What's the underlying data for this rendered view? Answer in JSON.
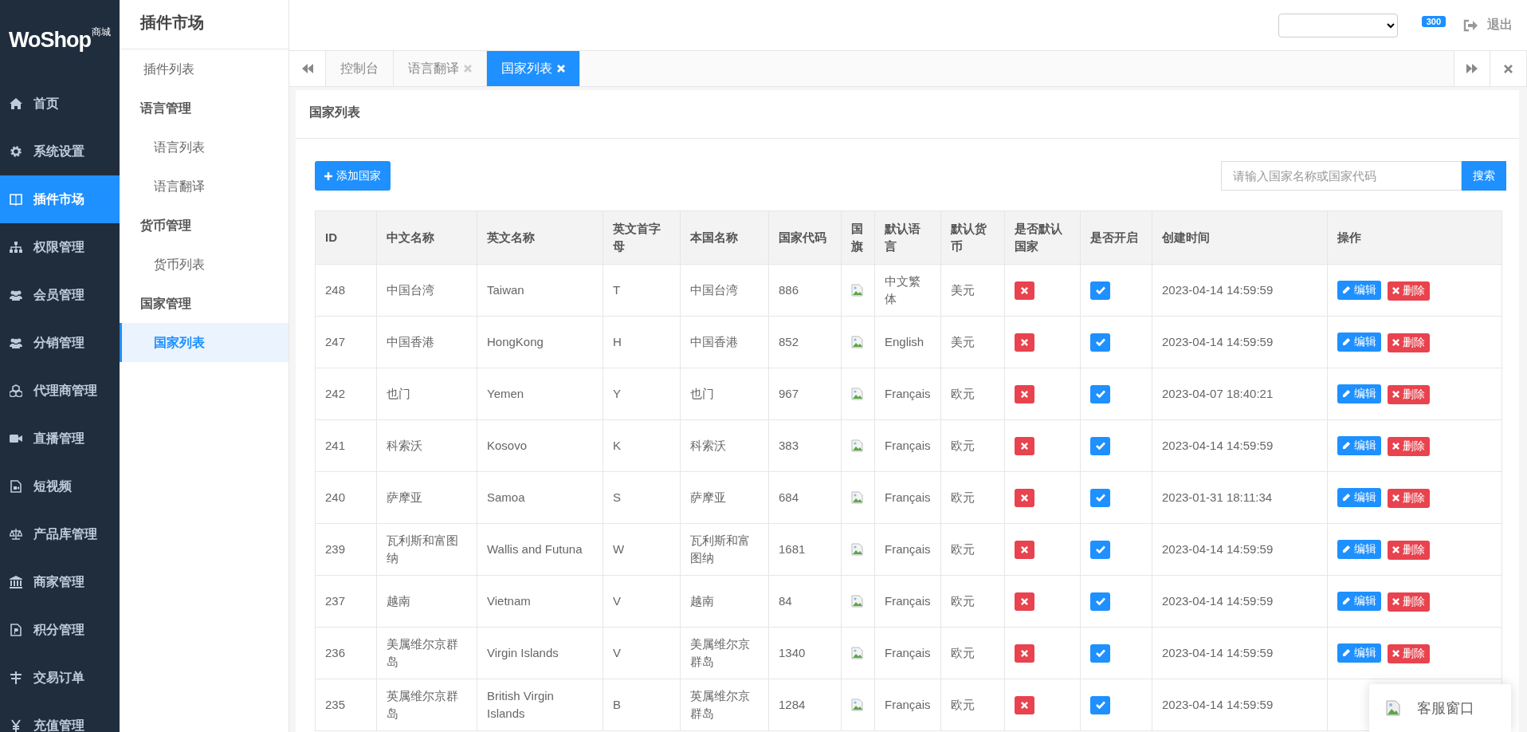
{
  "logo": {
    "text": "WoShop",
    "tag": "商城"
  },
  "nav": [
    {
      "label": "首页",
      "selected": false
    },
    {
      "label": "系统设置",
      "selected": false
    },
    {
      "label": "插件市场",
      "selected": true
    },
    {
      "label": "权限管理",
      "selected": false
    },
    {
      "label": "会员管理",
      "selected": false
    },
    {
      "label": "分销管理",
      "selected": false
    },
    {
      "label": "代理商管理",
      "selected": false
    },
    {
      "label": "直播管理",
      "selected": false
    },
    {
      "label": "短视频",
      "selected": false
    },
    {
      "label": "产品库管理",
      "selected": false
    },
    {
      "label": "商家管理",
      "selected": false
    },
    {
      "label": "积分管理",
      "selected": false
    },
    {
      "label": "交易订单",
      "selected": false
    },
    {
      "label": "充值管理",
      "selected": false
    }
  ],
  "subnav": {
    "title": "插件市场",
    "items": [
      {
        "label": "插件列表",
        "selected": false
      },
      {
        "label": "语言管理",
        "children": [
          {
            "label": "语言列表",
            "selected": false
          },
          {
            "label": "语言翻译",
            "selected": false
          }
        ]
      },
      {
        "label": "货币管理",
        "children": [
          {
            "label": "货币列表",
            "selected": false
          }
        ]
      },
      {
        "label": "国家管理",
        "children": [
          {
            "label": "国家列表",
            "selected": true
          }
        ]
      }
    ]
  },
  "topbar": {
    "badge": "300",
    "logout": "退出"
  },
  "tabs": [
    {
      "label": "控制台",
      "closable": false,
      "selected": false
    },
    {
      "label": "语言翻译",
      "closable": true,
      "selected": false
    },
    {
      "label": "国家列表",
      "closable": true,
      "selected": true
    }
  ],
  "panel": {
    "title": "国家列表",
    "add_button": "添加国家",
    "search": {
      "placeholder": "请输入国家名称或国家代码",
      "button": "搜索"
    }
  },
  "table": {
    "columns": [
      "ID",
      "中文名称",
      "英文名称",
      "英文首字母",
      "本国名称",
      "国家代码",
      "国旗",
      "默认语言",
      "默认货币",
      "是否默认国家",
      "是否开启",
      "创建时间",
      "操作"
    ],
    "rows": [
      {
        "id": "248",
        "cn": "中国台湾",
        "en": "Taiwan",
        "initial": "T",
        "native": "中国台湾",
        "code": "886",
        "language": "中文繁体",
        "currency": "美元",
        "is_default": false,
        "enabled": true,
        "created": "2023-04-14 14:59:59",
        "actions": [
          "编辑",
          "删除"
        ]
      },
      {
        "id": "247",
        "cn": "中国香港",
        "en": "HongKong",
        "initial": "H",
        "native": "中国香港",
        "code": "852",
        "language": "English",
        "currency": "美元",
        "is_default": false,
        "enabled": true,
        "created": "2023-04-14 14:59:59",
        "actions": [
          "编辑",
          "删除"
        ]
      },
      {
        "id": "242",
        "cn": "也门",
        "en": "Yemen",
        "initial": "Y",
        "native": "也门",
        "code": "967",
        "language": "Français",
        "currency": "欧元",
        "is_default": false,
        "enabled": true,
        "created": "2023-04-07 18:40:21",
        "actions": [
          "编辑",
          "删除"
        ]
      },
      {
        "id": "241",
        "cn": "科索沃",
        "en": "Kosovo",
        "initial": "K",
        "native": "科索沃",
        "code": "383",
        "language": "Français",
        "currency": "欧元",
        "is_default": false,
        "enabled": true,
        "created": "2023-04-14 14:59:59",
        "actions": [
          "编辑",
          "删除"
        ]
      },
      {
        "id": "240",
        "cn": "萨摩亚",
        "en": "Samoa",
        "initial": "S",
        "native": "萨摩亚",
        "code": "684",
        "language": "Français",
        "currency": "欧元",
        "is_default": false,
        "enabled": true,
        "created": "2023-01-31 18:11:34",
        "actions": [
          "编辑",
          "删除"
        ]
      },
      {
        "id": "239",
        "cn": "瓦利斯和富图纳",
        "en": "Wallis and Futuna",
        "initial": "W",
        "native": "瓦利斯和富图纳",
        "code": "1681",
        "language": "Français",
        "currency": "欧元",
        "is_default": false,
        "enabled": true,
        "created": "2023-04-14 14:59:59",
        "actions": [
          "编辑",
          "删除"
        ]
      },
      {
        "id": "237",
        "cn": "越南",
        "en": "Vietnam",
        "initial": "V",
        "native": "越南",
        "code": "84",
        "language": "Français",
        "currency": "欧元",
        "is_default": false,
        "enabled": true,
        "created": "2023-04-14 14:59:59",
        "actions": [
          "编辑",
          "删除"
        ]
      },
      {
        "id": "236",
        "cn": "美属维尔京群岛",
        "en": "Virgin Islands",
        "initial": "V",
        "native": "美属维尔京群岛",
        "code": "1340",
        "language": "Français",
        "currency": "欧元",
        "is_default": false,
        "enabled": true,
        "created": "2023-04-14 14:59:59",
        "actions": [
          "编辑",
          "删除"
        ]
      },
      {
        "id": "235",
        "cn": "英属维尔京群岛",
        "en": "British Virgin Islands",
        "initial": "B",
        "native": "英属维尔京群岛",
        "code": "1284",
        "language": "Français",
        "currency": "欧元",
        "is_default": false,
        "enabled": true,
        "created": "2023-04-14 14:59:59",
        "actions": []
      }
    ]
  },
  "chat": {
    "label": "客服窗口"
  }
}
